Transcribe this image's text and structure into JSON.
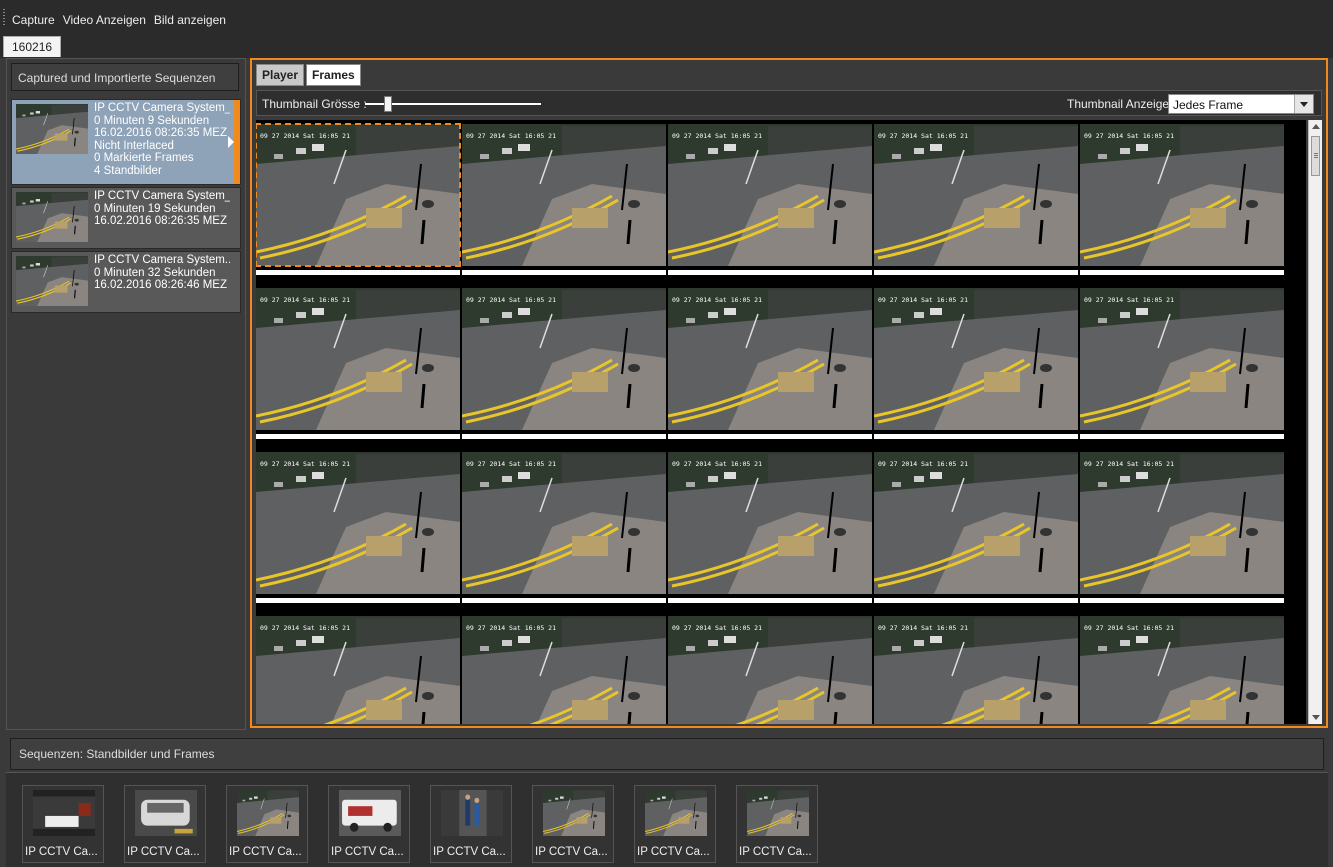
{
  "menu": {
    "items": [
      "Capture",
      "Video Anzeigen",
      "Bild anzeigen"
    ]
  },
  "project_tab": "160216",
  "left_panel": {
    "header": "Captured und Importierte Sequenzen",
    "sequences": [
      {
        "title": "IP CCTV Camera System_",
        "duration": "0 Minuten 9 Sekunden",
        "date": "16.02.2016 08:26:35 MEZ",
        "interlace": "Nicht Interlaced",
        "marked": "0 Markierte Frames",
        "stills": "4 Standbilder"
      },
      {
        "title": "IP CCTV Camera System_...",
        "duration": "0 Minuten 19 Sekunden",
        "date": "16.02.2016 08:26:35 MEZ"
      },
      {
        "title": "IP CCTV Camera System....",
        "duration": "0 Minuten 32 Sekunden",
        "date": "16.02.2016 08:26:46 MEZ"
      }
    ]
  },
  "view_tabs": [
    "Player",
    "Frames"
  ],
  "active_view_tab": "Frames",
  "toolbar": {
    "thumb_size_label": "Thumbnail Grösse :",
    "thumb_size_fraction": 0.13,
    "thumb_display_label": "Thumbnail Anzeige:",
    "thumb_display_value": "Jedes Frame"
  },
  "frames": {
    "columns": 5,
    "rows": 4,
    "overlay_text": "09 27 2014 Sat 16:05 21",
    "selected_index": 0
  },
  "bottom_panel": {
    "header": "Sequenzen: Standbilder und Frames",
    "items": [
      {
        "label": "IP CCTV Ca...",
        "kind": "car-plate"
      },
      {
        "label": "IP CCTV Ca...",
        "kind": "white-car"
      },
      {
        "label": "IP CCTV Ca...",
        "kind": "street"
      },
      {
        "label": "IP CCTV Ca...",
        "kind": "van"
      },
      {
        "label": "IP CCTV Ca...",
        "kind": "people"
      },
      {
        "label": "IP CCTV Ca...",
        "kind": "street"
      },
      {
        "label": "IP CCTV Ca...",
        "kind": "street"
      },
      {
        "label": "IP CCTV Ca...",
        "kind": "street"
      }
    ]
  },
  "colors": {
    "accent": "#f08a1c",
    "selected_row": "#8ea2b8",
    "background": "#3a3a3a"
  }
}
